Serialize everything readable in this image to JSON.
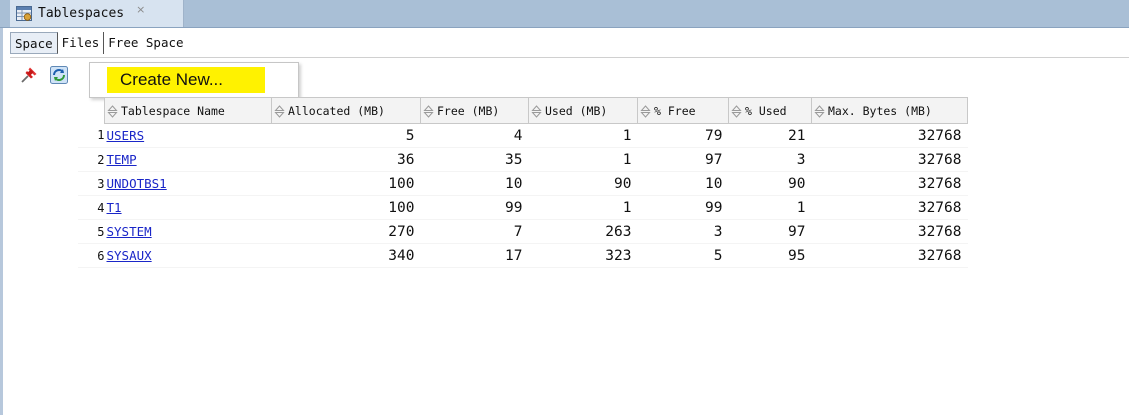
{
  "window": {
    "tab_title": "Tablespaces",
    "tab_close": "×"
  },
  "subtabs": [
    {
      "label": "Space",
      "active": true
    },
    {
      "label": "Files",
      "active": false
    },
    {
      "label": "Free Space",
      "active": false
    }
  ],
  "toolbar": {
    "pin_icon": "pin-icon",
    "refresh_icon": "refresh-icon"
  },
  "context_menu": {
    "items": [
      {
        "label": "Create New...",
        "highlight_color": "#fff200"
      }
    ]
  },
  "table": {
    "columns": [
      "Tablespace Name",
      "Allocated (MB)",
      "Free (MB)",
      "Used (MB)",
      "% Free",
      "% Used",
      "Max. Bytes (MB)"
    ],
    "rows": [
      {
        "num": "1",
        "name": "USERS",
        "allocated": "5",
        "free": "4",
        "used": "1",
        "pct_free": "79",
        "pct_used": "21",
        "max_bytes": "32768"
      },
      {
        "num": "2",
        "name": "TEMP",
        "allocated": "36",
        "free": "35",
        "used": "1",
        "pct_free": "97",
        "pct_used": "3",
        "max_bytes": "32768"
      },
      {
        "num": "3",
        "name": "UNDOTBS1",
        "allocated": "100",
        "free": "10",
        "used": "90",
        "pct_free": "10",
        "pct_used": "90",
        "max_bytes": "32768"
      },
      {
        "num": "4",
        "name": "T1",
        "allocated": "100",
        "free": "99",
        "used": "1",
        "pct_free": "99",
        "pct_used": "1",
        "max_bytes": "32768"
      },
      {
        "num": "5",
        "name": "SYSTEM",
        "allocated": "270",
        "free": "7",
        "used": "263",
        "pct_free": "3",
        "pct_used": "97",
        "max_bytes": "32768"
      },
      {
        "num": "6",
        "name": "SYSAUX",
        "allocated": "340",
        "free": "17",
        "used": "323",
        "pct_free": "5",
        "pct_used": "95",
        "max_bytes": "32768"
      }
    ]
  },
  "colors": {
    "link": "#1a26c8",
    "menu_highlight": "#fff200",
    "tabbar": "#a9bfd6"
  }
}
